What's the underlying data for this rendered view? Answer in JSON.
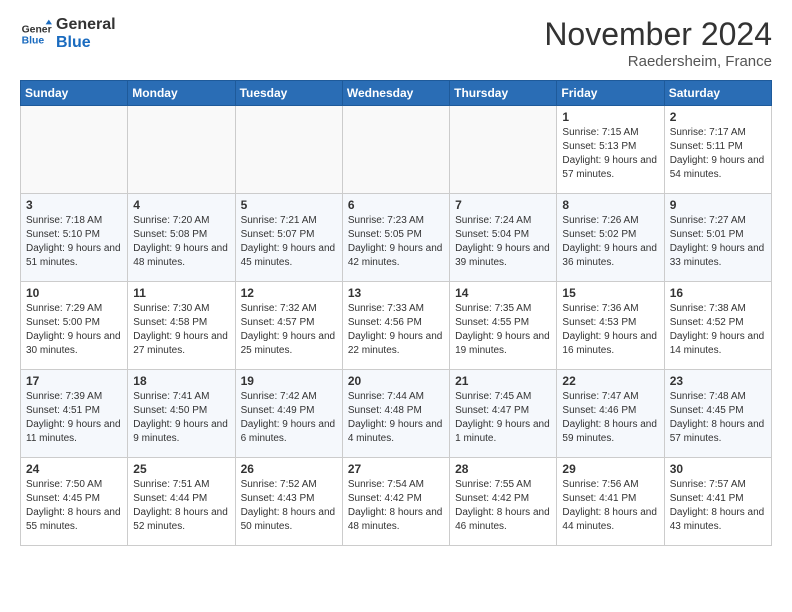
{
  "header": {
    "logo_line1": "General",
    "logo_line2": "Blue",
    "month_title": "November 2024",
    "location": "Raedersheim, France"
  },
  "weekdays": [
    "Sunday",
    "Monday",
    "Tuesday",
    "Wednesday",
    "Thursday",
    "Friday",
    "Saturday"
  ],
  "weeks": [
    [
      {
        "day": "",
        "info": ""
      },
      {
        "day": "",
        "info": ""
      },
      {
        "day": "",
        "info": ""
      },
      {
        "day": "",
        "info": ""
      },
      {
        "day": "",
        "info": ""
      },
      {
        "day": "1",
        "info": "Sunrise: 7:15 AM\nSunset: 5:13 PM\nDaylight: 9 hours and 57 minutes."
      },
      {
        "day": "2",
        "info": "Sunrise: 7:17 AM\nSunset: 5:11 PM\nDaylight: 9 hours and 54 minutes."
      }
    ],
    [
      {
        "day": "3",
        "info": "Sunrise: 7:18 AM\nSunset: 5:10 PM\nDaylight: 9 hours and 51 minutes."
      },
      {
        "day": "4",
        "info": "Sunrise: 7:20 AM\nSunset: 5:08 PM\nDaylight: 9 hours and 48 minutes."
      },
      {
        "day": "5",
        "info": "Sunrise: 7:21 AM\nSunset: 5:07 PM\nDaylight: 9 hours and 45 minutes."
      },
      {
        "day": "6",
        "info": "Sunrise: 7:23 AM\nSunset: 5:05 PM\nDaylight: 9 hours and 42 minutes."
      },
      {
        "day": "7",
        "info": "Sunrise: 7:24 AM\nSunset: 5:04 PM\nDaylight: 9 hours and 39 minutes."
      },
      {
        "day": "8",
        "info": "Sunrise: 7:26 AM\nSunset: 5:02 PM\nDaylight: 9 hours and 36 minutes."
      },
      {
        "day": "9",
        "info": "Sunrise: 7:27 AM\nSunset: 5:01 PM\nDaylight: 9 hours and 33 minutes."
      }
    ],
    [
      {
        "day": "10",
        "info": "Sunrise: 7:29 AM\nSunset: 5:00 PM\nDaylight: 9 hours and 30 minutes."
      },
      {
        "day": "11",
        "info": "Sunrise: 7:30 AM\nSunset: 4:58 PM\nDaylight: 9 hours and 27 minutes."
      },
      {
        "day": "12",
        "info": "Sunrise: 7:32 AM\nSunset: 4:57 PM\nDaylight: 9 hours and 25 minutes."
      },
      {
        "day": "13",
        "info": "Sunrise: 7:33 AM\nSunset: 4:56 PM\nDaylight: 9 hours and 22 minutes."
      },
      {
        "day": "14",
        "info": "Sunrise: 7:35 AM\nSunset: 4:55 PM\nDaylight: 9 hours and 19 minutes."
      },
      {
        "day": "15",
        "info": "Sunrise: 7:36 AM\nSunset: 4:53 PM\nDaylight: 9 hours and 16 minutes."
      },
      {
        "day": "16",
        "info": "Sunrise: 7:38 AM\nSunset: 4:52 PM\nDaylight: 9 hours and 14 minutes."
      }
    ],
    [
      {
        "day": "17",
        "info": "Sunrise: 7:39 AM\nSunset: 4:51 PM\nDaylight: 9 hours and 11 minutes."
      },
      {
        "day": "18",
        "info": "Sunrise: 7:41 AM\nSunset: 4:50 PM\nDaylight: 9 hours and 9 minutes."
      },
      {
        "day": "19",
        "info": "Sunrise: 7:42 AM\nSunset: 4:49 PM\nDaylight: 9 hours and 6 minutes."
      },
      {
        "day": "20",
        "info": "Sunrise: 7:44 AM\nSunset: 4:48 PM\nDaylight: 9 hours and 4 minutes."
      },
      {
        "day": "21",
        "info": "Sunrise: 7:45 AM\nSunset: 4:47 PM\nDaylight: 9 hours and 1 minute."
      },
      {
        "day": "22",
        "info": "Sunrise: 7:47 AM\nSunset: 4:46 PM\nDaylight: 8 hours and 59 minutes."
      },
      {
        "day": "23",
        "info": "Sunrise: 7:48 AM\nSunset: 4:45 PM\nDaylight: 8 hours and 57 minutes."
      }
    ],
    [
      {
        "day": "24",
        "info": "Sunrise: 7:50 AM\nSunset: 4:45 PM\nDaylight: 8 hours and 55 minutes."
      },
      {
        "day": "25",
        "info": "Sunrise: 7:51 AM\nSunset: 4:44 PM\nDaylight: 8 hours and 52 minutes."
      },
      {
        "day": "26",
        "info": "Sunrise: 7:52 AM\nSunset: 4:43 PM\nDaylight: 8 hours and 50 minutes."
      },
      {
        "day": "27",
        "info": "Sunrise: 7:54 AM\nSunset: 4:42 PM\nDaylight: 8 hours and 48 minutes."
      },
      {
        "day": "28",
        "info": "Sunrise: 7:55 AM\nSunset: 4:42 PM\nDaylight: 8 hours and 46 minutes."
      },
      {
        "day": "29",
        "info": "Sunrise: 7:56 AM\nSunset: 4:41 PM\nDaylight: 8 hours and 44 minutes."
      },
      {
        "day": "30",
        "info": "Sunrise: 7:57 AM\nSunset: 4:41 PM\nDaylight: 8 hours and 43 minutes."
      }
    ]
  ]
}
